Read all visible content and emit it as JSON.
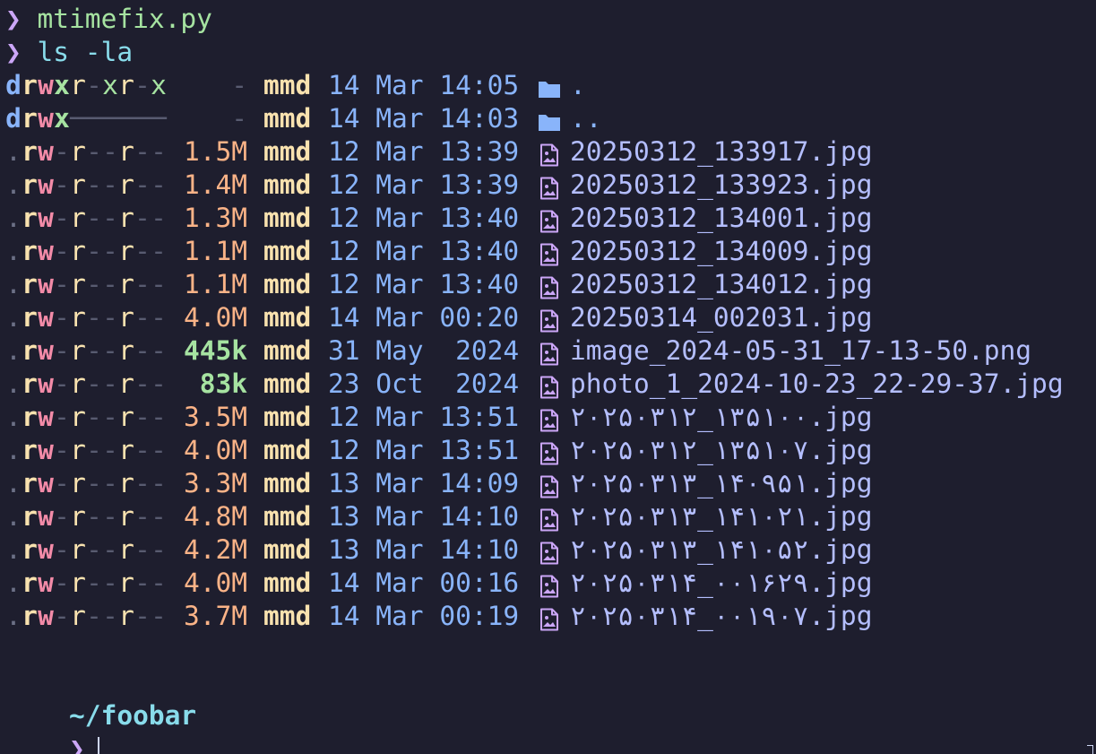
{
  "prompt_symbol": "❯",
  "history": [
    {
      "cmd": "mtimefix.py",
      "style": "green"
    },
    {
      "cmd": "ls -la",
      "style": "blue"
    }
  ],
  "listing": [
    {
      "perms": "drwxr-xr-x",
      "size": "-",
      "size_style": "none",
      "user": "mmd",
      "date": "14 Mar 14:05",
      "type": "folder",
      "name": "."
    },
    {
      "perms": "drwx------",
      "size": "-",
      "size_style": "none",
      "user": "mmd",
      "date": "14 Mar 14:03",
      "type": "folder",
      "name": ".."
    },
    {
      "perms": ".rw-r--r--",
      "size": "1.5M",
      "size_style": "normal",
      "user": "mmd",
      "date": "12 Mar 13:39",
      "type": "image",
      "name": "20250312_133917.jpg"
    },
    {
      "perms": ".rw-r--r--",
      "size": "1.4M",
      "size_style": "normal",
      "user": "mmd",
      "date": "12 Mar 13:39",
      "type": "image",
      "name": "20250312_133923.jpg"
    },
    {
      "perms": ".rw-r--r--",
      "size": "1.3M",
      "size_style": "normal",
      "user": "mmd",
      "date": "12 Mar 13:40",
      "type": "image",
      "name": "20250312_134001.jpg"
    },
    {
      "perms": ".rw-r--r--",
      "size": "1.1M",
      "size_style": "normal",
      "user": "mmd",
      "date": "12 Mar 13:40",
      "type": "image",
      "name": "20250312_134009.jpg"
    },
    {
      "perms": ".rw-r--r--",
      "size": "1.1M",
      "size_style": "normal",
      "user": "mmd",
      "date": "12 Mar 13:40",
      "type": "image",
      "name": "20250312_134012.jpg"
    },
    {
      "perms": ".rw-r--r--",
      "size": "4.0M",
      "size_style": "normal",
      "user": "mmd",
      "date": "14 Mar 00:20",
      "type": "image",
      "name": "20250314_002031.jpg"
    },
    {
      "perms": ".rw-r--r--",
      "size": "445k",
      "size_style": "small",
      "user": "mmd",
      "date": "31 May  2024",
      "type": "image",
      "name": "image_2024-05-31_17-13-50.png"
    },
    {
      "perms": ".rw-r--r--",
      "size": "83k",
      "size_style": "small",
      "user": "mmd",
      "date": "23 Oct  2024",
      "type": "image",
      "name": "photo_1_2024-10-23_22-29-37.jpg"
    },
    {
      "perms": ".rw-r--r--",
      "size": "3.5M",
      "size_style": "normal",
      "user": "mmd",
      "date": "12 Mar 13:51",
      "type": "image",
      "name": "۲۰۲۵۰۳۱۲_۱۳۵۱۰۰.jpg"
    },
    {
      "perms": ".rw-r--r--",
      "size": "4.0M",
      "size_style": "normal",
      "user": "mmd",
      "date": "12 Mar 13:51",
      "type": "image",
      "name": "۲۰۲۵۰۳۱۲_۱۳۵۱۰۷.jpg"
    },
    {
      "perms": ".rw-r--r--",
      "size": "3.3M",
      "size_style": "normal",
      "user": "mmd",
      "date": "13 Mar 14:09",
      "type": "image",
      "name": "۲۰۲۵۰۳۱۳_۱۴۰۹۵۱.jpg"
    },
    {
      "perms": ".rw-r--r--",
      "size": "4.8M",
      "size_style": "normal",
      "user": "mmd",
      "date": "13 Mar 14:10",
      "type": "image",
      "name": "۲۰۲۵۰۳۱۳_۱۴۱۰۲۱.jpg"
    },
    {
      "perms": ".rw-r--r--",
      "size": "4.2M",
      "size_style": "normal",
      "user": "mmd",
      "date": "13 Mar 14:10",
      "type": "image",
      "name": "۲۰۲۵۰۳۱۳_۱۴۱۰۵۲.jpg"
    },
    {
      "perms": ".rw-r--r--",
      "size": "4.0M",
      "size_style": "normal",
      "user": "mmd",
      "date": "14 Mar 00:16",
      "type": "image",
      "name": "۲۰۲۵۰۳۱۴_۰۰۱۶۲۹.jpg"
    },
    {
      "perms": ".rw-r--r--",
      "size": "3.7M",
      "size_style": "normal",
      "user": "mmd",
      "date": "14 Mar 00:19",
      "type": "image",
      "name": "۲۰۲۵۰۳۱۴_۰۰۱۹۰۷.jpg"
    }
  ],
  "cwd": "~/foobar",
  "colors": {
    "background": "#1e1e2e",
    "prompt": "#cba6f7",
    "folder_icon": "#89b4fa",
    "file_icon": "#cba6f7"
  }
}
